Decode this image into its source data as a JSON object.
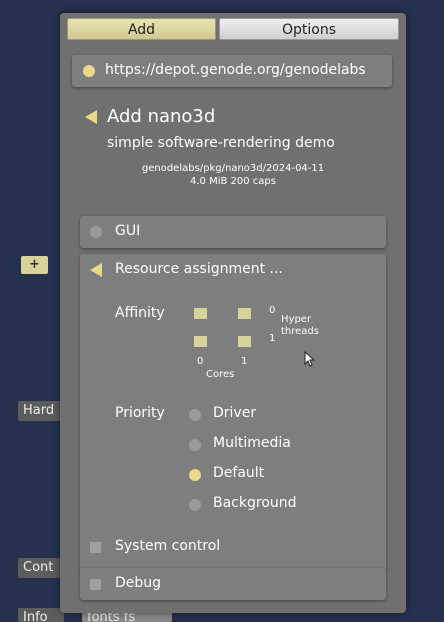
{
  "background": {
    "plus_label": "+",
    "hardware_label": "Hard",
    "control_label": "Cont",
    "info_label": "Info",
    "fonts_label": "fonts fs"
  },
  "tabs": {
    "add_label": "Add",
    "options_label": "Options"
  },
  "depot": {
    "url": "https://depot.genode.org/genodelabs"
  },
  "package": {
    "title": "Add nano3d",
    "subtitle": "simple software-rendering demo",
    "path": "genodelabs/pkg/nano3d/2024-04-11",
    "size_caps": "4.0 MiB 200 caps"
  },
  "gui": {
    "label": "GUI"
  },
  "resources": {
    "label": "Resource assignment ...",
    "affinity_label": "Affinity",
    "hyper_threads": {
      "index_0": "0",
      "index_1": "1",
      "label_line1": "Hyper",
      "label_line2": "threads"
    },
    "cores": {
      "index_0": "0",
      "index_1": "1",
      "label": "Cores"
    },
    "priority_label": "Priority",
    "priorities": [
      {
        "label": "Driver",
        "selected": false
      },
      {
        "label": "Multimedia",
        "selected": false
      },
      {
        "label": "Default",
        "selected": true
      },
      {
        "label": "Background",
        "selected": false
      }
    ],
    "system_control_label": "System control"
  },
  "debug": {
    "label": "Debug"
  },
  "colors": {
    "accent": "#ead88d",
    "dialog": "#707070",
    "row": "#7e7e7e",
    "desktop": "#24314f"
  }
}
